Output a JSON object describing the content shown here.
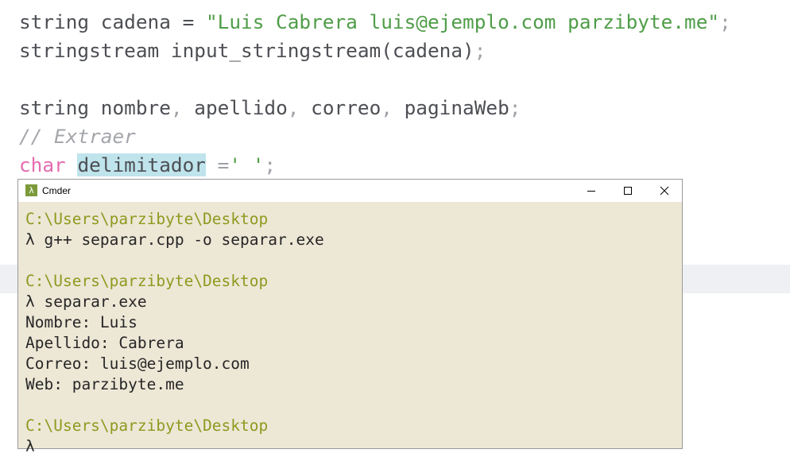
{
  "editor": {
    "line1": {
      "kw": "string cadena = ",
      "str": "\"Luis Cabrera luis@ejemplo.com parzibyte.me\"",
      "end": ";"
    },
    "line2": {
      "code": "stringstream input_stringstream(cadena)",
      "end": ";"
    },
    "line4": {
      "kw": "string ",
      "v1": "nombre",
      "c1": ", ",
      "v2": "apellido",
      "c2": ", ",
      "v3": "correo",
      "c3": ", ",
      "v4": "paginaWeb",
      "end": ";"
    },
    "line5": {
      "comment": "// Extraer"
    },
    "line6": {
      "kw": "char",
      "sp": " ",
      "hl": "delimitador",
      "op": " =",
      "str": "' '",
      "end": ";"
    }
  },
  "terminal": {
    "title": "Cmder",
    "icon_glyph": "λ",
    "lines": [
      {
        "path": "C:\\Users\\parzibyte\\Desktop"
      },
      {
        "text": "λ g++ separar.cpp -o separar.exe"
      },
      {
        "path": "C:\\Users\\parzibyte\\Desktop"
      },
      {
        "text": "λ separar.exe"
      },
      {
        "text": "Nombre: Luis"
      },
      {
        "text": "Apellido: Cabrera"
      },
      {
        "text": "Correo: luis@ejemplo.com"
      },
      {
        "text": "Web: parzibyte.me"
      },
      {
        "path": "C:\\Users\\parzibyte\\Desktop"
      },
      {
        "text": "λ"
      }
    ]
  },
  "icons": {
    "minimize": "minimize-icon",
    "maximize": "maximize-icon",
    "close": "close-icon"
  }
}
